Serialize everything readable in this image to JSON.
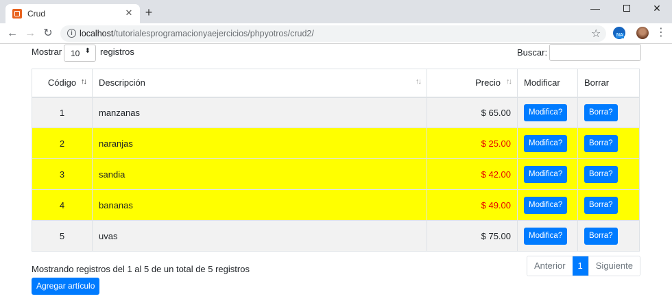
{
  "browser": {
    "tab_title": "Crud",
    "tab_close": "✕",
    "new_tab": "+",
    "url_host": "localhost",
    "url_path": "/tutorialesprogramacionyaejercicios/phpyotros/crud2/"
  },
  "controls": {
    "show_label": "Mostrar",
    "page_length": "10",
    "records_label": "registros",
    "search_label": "Buscar:",
    "search_value": ""
  },
  "table": {
    "headers": {
      "code": "Código",
      "description": "Descripción",
      "price": "Precio",
      "modify": "Modificar",
      "delete": "Borrar"
    },
    "rows": [
      {
        "code": "1",
        "description": "manzanas",
        "price": "$ 65.00",
        "modify": "Modifica?",
        "delete": "Borra?",
        "highlight": false
      },
      {
        "code": "2",
        "description": "naranjas",
        "price": "$ 25.00",
        "modify": "Modifica?",
        "delete": "Borra?",
        "highlight": true
      },
      {
        "code": "3",
        "description": "sandia",
        "price": "$ 42.00",
        "modify": "Modifica?",
        "delete": "Borra?",
        "highlight": true
      },
      {
        "code": "4",
        "description": "bananas",
        "price": "$ 49.00",
        "modify": "Modifica?",
        "delete": "Borra?",
        "highlight": true
      },
      {
        "code": "5",
        "description": "uvas",
        "price": "$ 75.00",
        "modify": "Modifica?",
        "delete": "Borra?",
        "highlight": false
      }
    ]
  },
  "footer": {
    "info": "Mostrando registros del 1 al 5 de un total de 5 registros",
    "add_button": "Agregar artículo",
    "prev": "Anterior",
    "current_page": "1",
    "next": "Siguiente"
  },
  "colors": {
    "primary": "#007bff",
    "highlight_row": "#ffff00",
    "highlight_price": "#e60000",
    "normal_row": "#f2f2f2"
  }
}
